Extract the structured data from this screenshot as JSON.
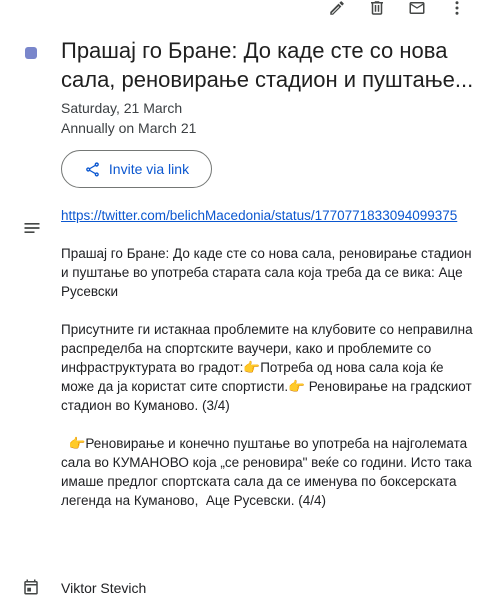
{
  "toolbar": {
    "icons": [
      "edit-icon",
      "delete-icon",
      "email-icon",
      "more-vert-icon",
      "close-icon"
    ]
  },
  "event": {
    "color": "#7986cb",
    "title": "Прашај го Бране: До каде сте со нова сала, реновирање стадион и пуштање...",
    "date": "Saturday, 21 March",
    "recurrence": "Annually on March 21"
  },
  "invite": {
    "label": "Invite via link"
  },
  "description": {
    "link": "https://twitter.com/belichMacedonia/status/1770771833094099375",
    "para1": "Прашај го Бране: До каде сте со нова сала, реновирање стадион и пуштање во употреба старата сала која треба да се вика: Аце Русевски",
    "para2": "Присутните ги истакнаа проблемите на клубовите со неправилна распределба на спортските ваучери, како и проблемите со инфраструктурата во градот:👉Потреба од нова сала која ќе може да ја користат сите спортисти.👉 Реновирање на градскиот стадион во Куманово. (3/4)",
    "para3": "  👉Реновирање и конечно пуштање во употреба на најголемата сала во КУМАНОВО која „се реновира\" веќе со години. Исто така имаше предлог спортската сала да се именува по боксерската легенда на Куманово,  Аце Русевски. (4/4)"
  },
  "owner": {
    "name": "Viktor Stevich"
  }
}
